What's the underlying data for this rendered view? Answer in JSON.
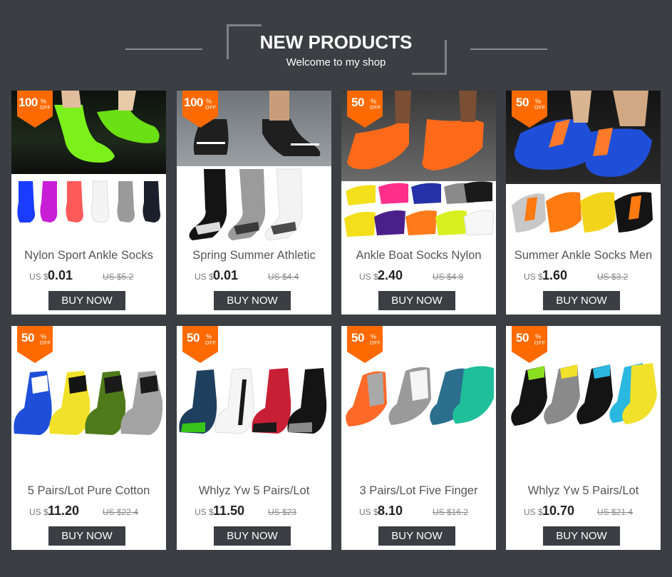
{
  "header": {
    "title": "NEW PRODUCTS",
    "subtitle": "Welcome to my shop"
  },
  "products": [
    {
      "name": "Nylon Sport Ankle Socks",
      "currency": "US $",
      "price": "0.01",
      "old_price": "US $5.2",
      "discount": "100",
      "pct": "%",
      "off": "OFF",
      "buy": "BUY NOW"
    },
    {
      "name": "Spring Summer Athletic",
      "currency": "US $",
      "price": "0.01",
      "old_price": "US $4.4",
      "discount": "100",
      "pct": "%",
      "off": "OFF",
      "buy": "BUY NOW"
    },
    {
      "name": "Ankle Boat Socks Nylon",
      "currency": "US $",
      "price": "2.40",
      "old_price": "US $4.8",
      "discount": "50",
      "pct": "%",
      "off": "OFF",
      "buy": "BUY NOW"
    },
    {
      "name": "Summer Ankle Socks Men",
      "currency": "US $",
      "price": "1.60",
      "old_price": "US $3.2",
      "discount": "50",
      "pct": "%",
      "off": "OFF",
      "buy": "BUY NOW"
    },
    {
      "name": "5 Pairs/Lot Pure Cotton",
      "currency": "US $",
      "price": "11.20",
      "old_price": "US $22.4",
      "discount": "50",
      "pct": "%",
      "off": "OFF",
      "buy": "BUY NOW"
    },
    {
      "name": "Whlyz Yw 5 Pairs/Lot",
      "currency": "US $",
      "price": "11.50",
      "old_price": "US $23",
      "discount": "50",
      "pct": "%",
      "off": "OFF",
      "buy": "BUY NOW"
    },
    {
      "name": "3 Pairs/Lot Five Finger",
      "currency": "US $",
      "price": "8.10",
      "old_price": "US $16.2",
      "discount": "50",
      "pct": "%",
      "off": "OFF",
      "buy": "BUY NOW"
    },
    {
      "name": "Whlyz Yw 5 Pairs/Lot",
      "currency": "US $",
      "price": "10.70",
      "old_price": "US $21.4",
      "discount": "50",
      "pct": "%",
      "off": "OFF",
      "buy": "BUY NOW"
    }
  ],
  "colors": {
    "background": "#3b3e42",
    "badge": "#ff6a00",
    "button": "#3b3e42"
  }
}
